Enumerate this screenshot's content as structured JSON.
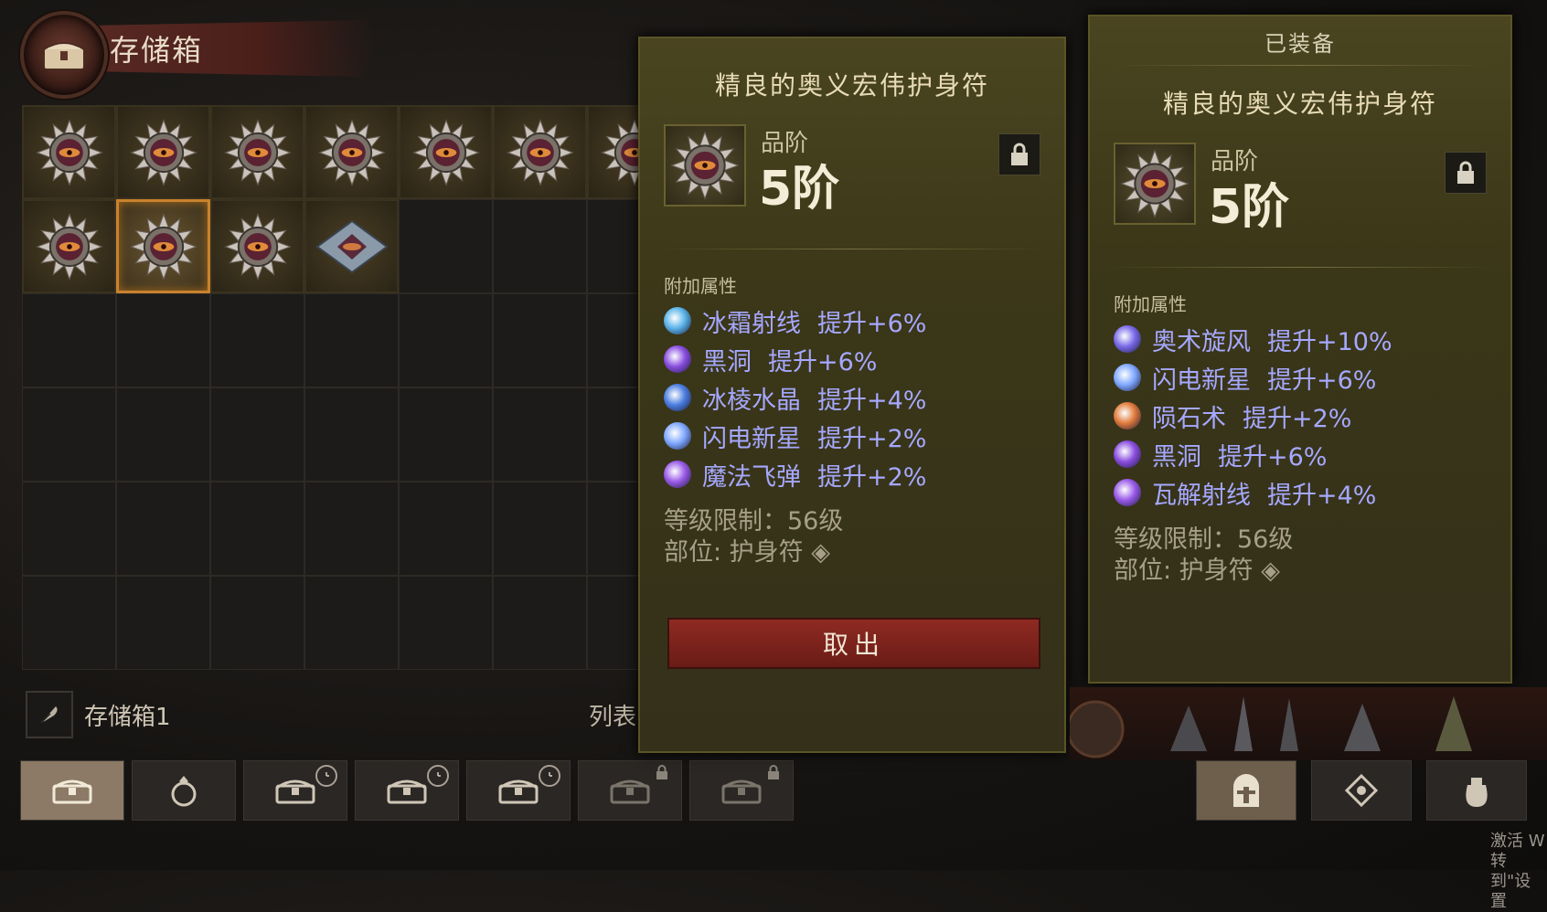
{
  "stash": {
    "title": "存储箱",
    "name": "存储箱1",
    "list_label": "列表"
  },
  "grid": {
    "columns": 7,
    "rows": 6,
    "items": [
      {
        "row": 0,
        "col": 0,
        "type": "amulet"
      },
      {
        "row": 0,
        "col": 1,
        "type": "amulet"
      },
      {
        "row": 0,
        "col": 2,
        "type": "amulet"
      },
      {
        "row": 0,
        "col": 3,
        "type": "amulet"
      },
      {
        "row": 0,
        "col": 4,
        "type": "amulet"
      },
      {
        "row": 0,
        "col": 5,
        "type": "amulet"
      },
      {
        "row": 0,
        "col": 6,
        "type": "amulet"
      },
      {
        "row": 1,
        "col": 0,
        "type": "amulet"
      },
      {
        "row": 1,
        "col": 1,
        "type": "amulet",
        "selected": true
      },
      {
        "row": 1,
        "col": 2,
        "type": "amulet"
      },
      {
        "row": 1,
        "col": 3,
        "type": "gem"
      }
    ]
  },
  "tabs": [
    {
      "icon": "chest-icon",
      "active": true
    },
    {
      "icon": "ring-icon"
    },
    {
      "icon": "chest-icon",
      "badge": "clock"
    },
    {
      "icon": "chest-icon",
      "badge": "clock"
    },
    {
      "icon": "chest-icon",
      "badge": "clock"
    },
    {
      "icon": "chest-icon",
      "badge": "lock"
    },
    {
      "icon": "chest-icon",
      "badge": "lock"
    }
  ],
  "tooltip_left": {
    "item_name": "精良的奥义宏伟护身符",
    "grade_label": "品阶",
    "grade_value": "5阶",
    "attr_title": "附加属性",
    "attributes": [
      {
        "skill": "冰霜射线",
        "bonus": "提升+6%",
        "color": "#5ab3e8"
      },
      {
        "skill": "黑洞",
        "bonus": "提升+6%",
        "color": "#8a4ee0"
      },
      {
        "skill": "冰棱水晶",
        "bonus": "提升+4%",
        "color": "#4a7ee0"
      },
      {
        "skill": "闪电新星",
        "bonus": "提升+2%",
        "color": "#7fa8ff"
      },
      {
        "skill": "魔法飞弹",
        "bonus": "提升+2%",
        "color": "#9a5ae8"
      }
    ],
    "level_req": "等级限制：56级",
    "slot": "部位: 护身符",
    "take_button": "取出"
  },
  "tooltip_right": {
    "equipped_label": "已装备",
    "item_name": "精良的奥义宏伟护身符",
    "grade_label": "品阶",
    "grade_value": "5阶",
    "attr_title": "附加属性",
    "attributes": [
      {
        "skill": "奥术旋风",
        "bonus": "提升+10%",
        "color": "#7a6ae8"
      },
      {
        "skill": "闪电新星",
        "bonus": "提升+6%",
        "color": "#7fa8ff"
      },
      {
        "skill": "陨石术",
        "bonus": "提升+2%",
        "color": "#e07a3a"
      },
      {
        "skill": "黑洞",
        "bonus": "提升+6%",
        "color": "#8a4ee0"
      },
      {
        "skill": "瓦解射线",
        "bonus": "提升+4%",
        "color": "#9a5ae8"
      }
    ],
    "level_req": "等级限制：56级",
    "slot": "部位: 护身符"
  },
  "equipment_tabs": [
    {
      "icon": "helmet-icon",
      "active": true
    },
    {
      "icon": "gem-icon"
    },
    {
      "icon": "bag-icon"
    }
  ],
  "watermark": {
    "line1": "激活 W",
    "line2": "转到\"设置"
  }
}
